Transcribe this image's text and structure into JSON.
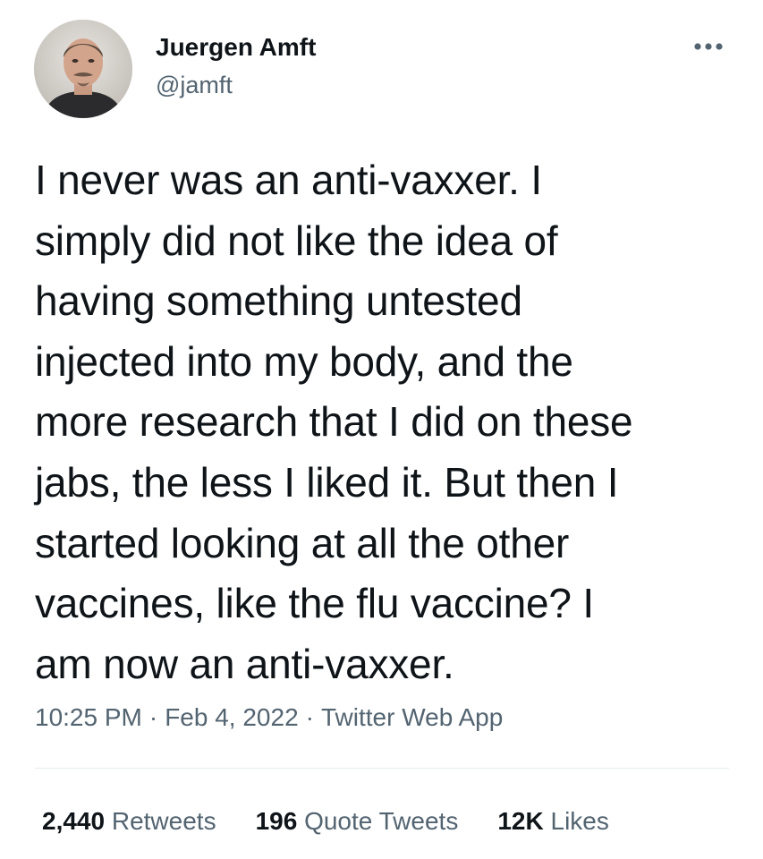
{
  "author": {
    "display_name": "Juergen Amft",
    "handle": "@jamft"
  },
  "menu_icon": "more-horizontal-icon",
  "tweet": {
    "text": "I never was an anti-vaxxer. I\nsimply did not like the idea of\nhaving something untested\ninjected into my body, and the\nmore research that I did on these\njabs, the less I liked it. But then I\nstarted looking at all the other\nvaccines, like the flu vaccine? I\nam now an anti-vaxxer."
  },
  "meta": {
    "time": "10:25 PM",
    "separator": "·",
    "date": "Feb 4, 2022",
    "source": "Twitter Web App"
  },
  "stats": {
    "retweets_count": "2,440",
    "retweets_label": "Retweets",
    "quotes_count": "196",
    "quotes_label": "Quote Tweets",
    "likes_count": "12K",
    "likes_label": "Likes"
  },
  "colors": {
    "text_primary": "#0f1419",
    "text_secondary": "#536471",
    "divider": "#e6ecf0",
    "background": "#ffffff"
  }
}
